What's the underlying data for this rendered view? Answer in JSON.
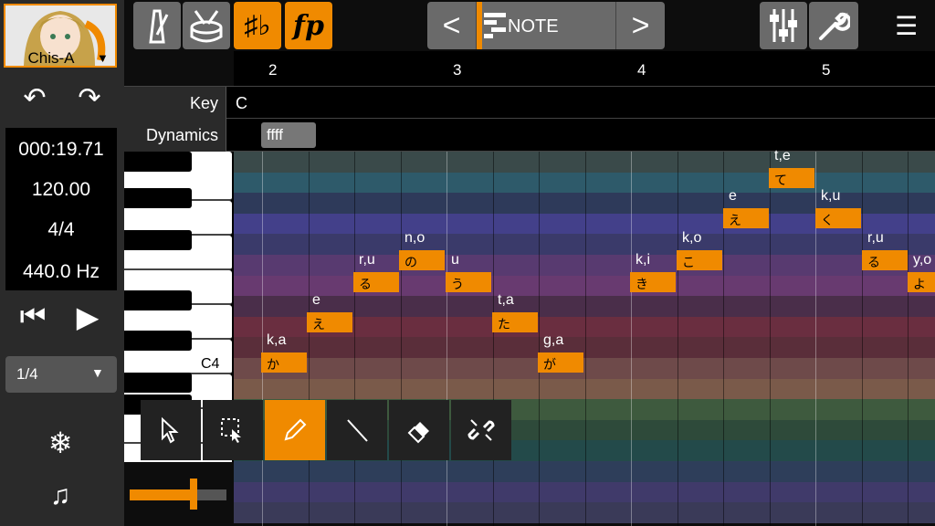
{
  "voice": {
    "name": "Chis-A"
  },
  "transport": {
    "time": "000:19.71",
    "tempo": "120.00",
    "time_signature": "4/4",
    "tuning": "440.0 Hz"
  },
  "quantize": {
    "selected": "1/4"
  },
  "toolbar": {
    "edit_mode": "NOTE"
  },
  "ruler": {
    "bars": [
      "2",
      "3",
      "4",
      "5"
    ]
  },
  "key_row": {
    "label": "Key",
    "value": "C"
  },
  "dynamics_row": {
    "label": "Dynamics",
    "value": "ffff"
  },
  "piano": {
    "c4_label": "C4"
  },
  "notes": [
    {
      "lyric": "k,a",
      "kana": "か"
    },
    {
      "lyric": "e",
      "kana": "え"
    },
    {
      "lyric": "r,u",
      "kana": "る"
    },
    {
      "lyric": "n,o",
      "kana": "の"
    },
    {
      "lyric": "u",
      "kana": "う"
    },
    {
      "lyric": "t,a",
      "kana": "た"
    },
    {
      "lyric": "g,a",
      "kana": "が"
    },
    {
      "lyric": "k,i",
      "kana": "き"
    },
    {
      "lyric": "k,o",
      "kana": "こ"
    },
    {
      "lyric": "e",
      "kana": "え"
    },
    {
      "lyric": "t,e",
      "kana": "て"
    },
    {
      "lyric": "k,u",
      "kana": "く"
    },
    {
      "lyric": "r,u",
      "kana": "る"
    },
    {
      "lyric": "y,o",
      "kana": "よ"
    }
  ],
  "colors": {
    "accent": "#f08a00",
    "panel": "#2a2a2a",
    "button": "#6a6a6a"
  },
  "icons": {
    "undo": "undo-icon",
    "redo": "redo-icon",
    "rewind": "skip-to-start-icon",
    "play": "play-icon",
    "freeze": "snowflake-icon",
    "file": "music-file-icon",
    "metronome": "metronome-icon",
    "drum": "drum-icon",
    "key": "sharp-flat-icon",
    "dynamics": "fp-icon",
    "mixer": "mixer-icon",
    "settings": "wrench-icon",
    "menu": "hamburger-menu-icon"
  }
}
